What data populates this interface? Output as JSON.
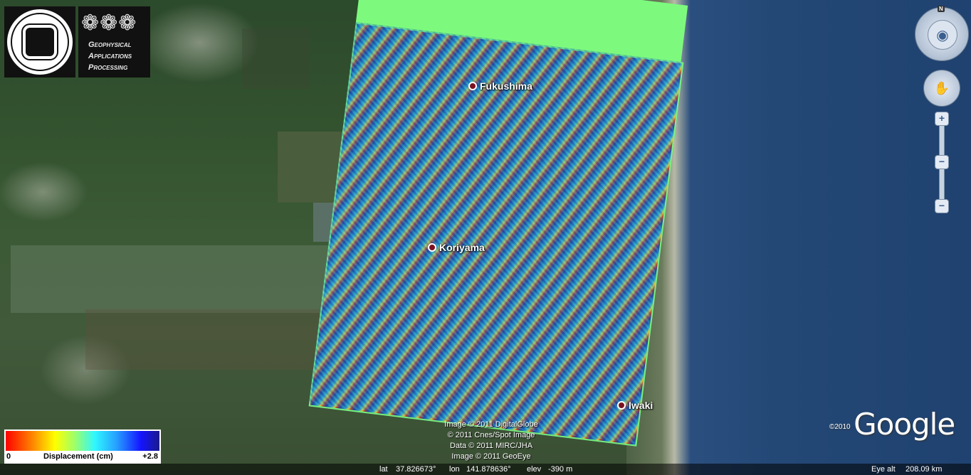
{
  "map": {
    "places": [
      {
        "name": "Fukushima"
      },
      {
        "name": "Koriyama"
      },
      {
        "name": "Iwaki"
      }
    ],
    "overlay_color_accent": "#7dfa7d"
  },
  "legend": {
    "title": "Displacement (cm)",
    "min": "0",
    "max": "+2.8",
    "colors": [
      "#ff0000",
      "#ff8a00",
      "#ffff00",
      "#2ff7ff",
      "#1414ff",
      "#1a1a8a"
    ]
  },
  "logos": {
    "seal_text": "POLITECNICO DI BARI",
    "gap_mark": "GAP",
    "gap_lines": [
      "Geophysical",
      "Applications",
      "Processing"
    ]
  },
  "credits": [
    "Image © 2011 DigitalGlobe",
    "© 2011 Cnes/Spot Image",
    "Data © 2011 MIRC/JHA",
    "Image © 2011 GeoEye"
  ],
  "google": {
    "copyright": "©2010",
    "wordmark": "Google"
  },
  "status": {
    "lat_label": "lat",
    "lat": "37.826673°",
    "lon_label": "lon",
    "lon": "141.878636°",
    "elev_label": "elev",
    "elev": "-390 m",
    "eye_label": "Eye alt",
    "eye": "208.09 km"
  },
  "nav": {
    "north": "N"
  }
}
